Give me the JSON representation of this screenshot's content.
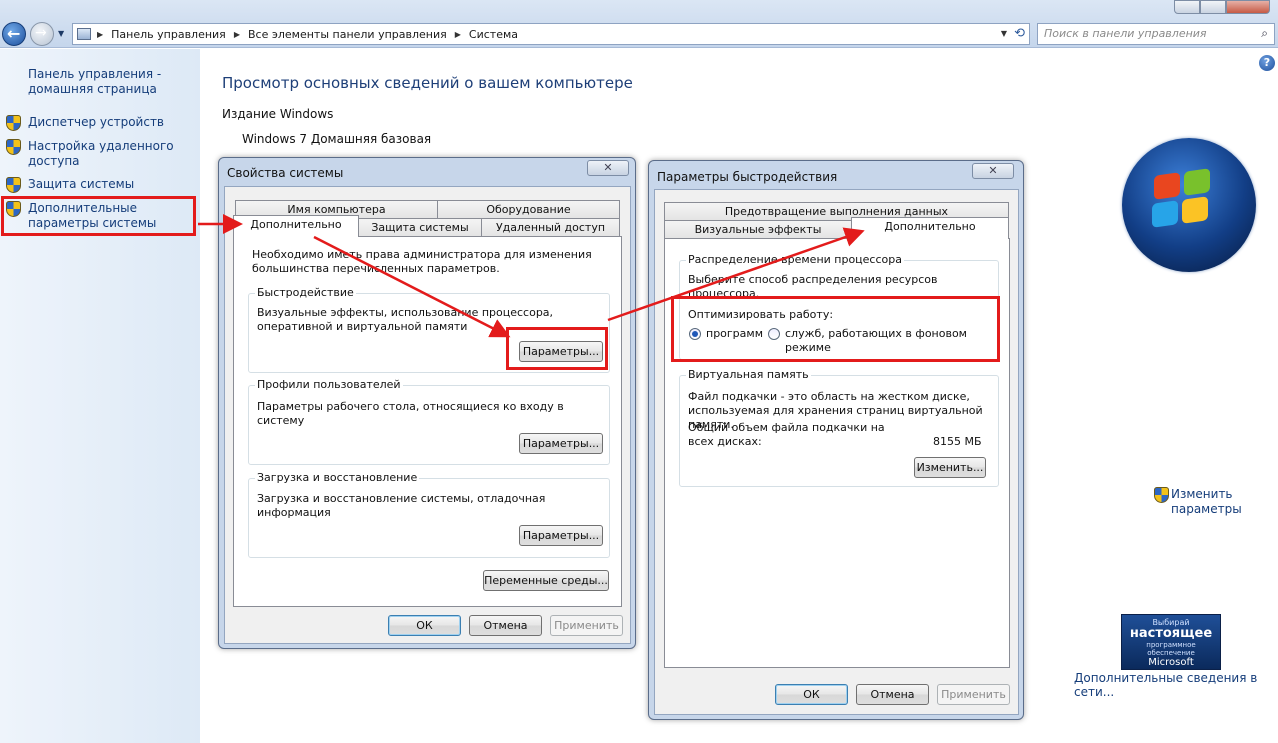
{
  "address": {
    "breadcrumbs": [
      "Панель управления",
      "Все элементы панели управления",
      "Система"
    ],
    "search_placeholder": "Поиск в панели управления"
  },
  "leftnav": {
    "home": "Панель управления - домашняя страница",
    "items": [
      {
        "label": "Диспетчер устройств"
      },
      {
        "label": "Настройка удаленного доступа"
      },
      {
        "label": "Защита системы"
      },
      {
        "label": "Дополнительные параметры системы"
      }
    ]
  },
  "main": {
    "title": "Просмотр основных сведений о вашем компьютере",
    "edition_label": "Издание Windows",
    "edition_value": "Windows 7 Домашняя базовая",
    "change_link": "Изменить параметры",
    "genuine": {
      "line1": "Выбирай",
      "line2": "настоящее",
      "line3": "программное обеспечение",
      "line4": "Microsoft"
    },
    "more_link": "Дополнительные сведения в сети..."
  },
  "sysprops": {
    "title": "Свойства системы",
    "tabs_top": [
      "Имя компьютера",
      "Оборудование"
    ],
    "tabs_bottom": [
      "Дополнительно",
      "Защита системы",
      "Удаленный доступ"
    ],
    "admin_note": "Необходимо иметь права администратора для изменения большинства перечисленных параметров.",
    "perf": {
      "title": "Быстродействие",
      "desc": "Визуальные эффекты, использование процессора, оперативной и виртуальной памяти",
      "button": "Параметры..."
    },
    "profiles": {
      "title": "Профили пользователей",
      "desc": "Параметры рабочего стола, относящиеся ко входу в систему",
      "button": "Параметры..."
    },
    "startup": {
      "title": "Загрузка и восстановление",
      "desc": "Загрузка и восстановление системы, отладочная информация",
      "button": "Параметры..."
    },
    "env_button": "Переменные среды...",
    "ok": "ОК",
    "cancel": "Отмена",
    "apply": "Применить"
  },
  "perfopts": {
    "title": "Параметры быстродействия",
    "tab_top": "Предотвращение выполнения данных",
    "tabs_bottom": [
      "Визуальные эффекты",
      "Дополнительно"
    ],
    "cpu": {
      "title": "Распределение времени процессора",
      "desc": "Выберите способ распределения ресурсов процессора.",
      "optimize_label": "Оптимизировать работу:",
      "opt_programs": "программ",
      "opt_services": "служб, работающих в фоновом режиме",
      "selected": "programs"
    },
    "vmem": {
      "title": "Виртуальная память",
      "desc": "Файл подкачки - это область на жестком диске, используемая для хранения страниц виртуальной памяти.",
      "total_label": "Общий объем файла подкачки на всех дисках:",
      "total_value": "8155 МБ",
      "button": "Изменить..."
    },
    "ok": "ОК",
    "cancel": "Отмена",
    "apply": "Применить"
  },
  "colors": {
    "highlight": "#e31b1b",
    "link": "#153d7a"
  }
}
